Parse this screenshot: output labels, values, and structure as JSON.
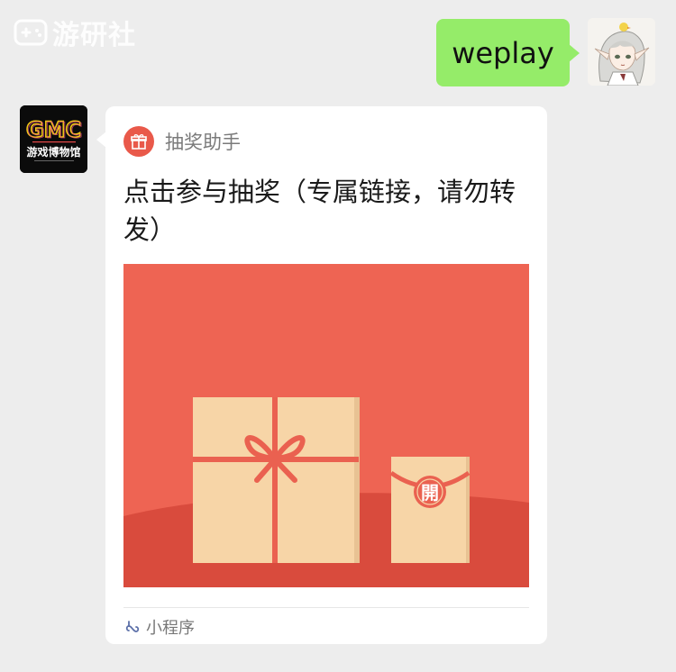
{
  "watermark": {
    "text": "游研社"
  },
  "outgoing": {
    "text": "weplay",
    "bubble_color": "#95ec69"
  },
  "incoming": {
    "avatar": {
      "logo_text": "GMC",
      "subtitle": "游戏博物馆"
    },
    "card": {
      "app_name": "抽奖助手",
      "title": "点击参与抽奖（专属链接，请勿转发）",
      "red_packet_char": "開",
      "footer_label": "小程序",
      "accent_color": "#e9594a"
    }
  }
}
